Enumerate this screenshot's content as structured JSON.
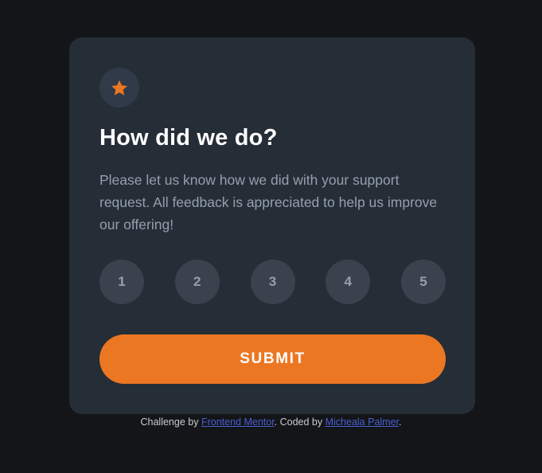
{
  "card": {
    "icon": "star-icon",
    "title": "How did we do?",
    "description": "Please let us know how we did with your support request. All feedback is appreciated to help us improve our offering!",
    "ratings": [
      "1",
      "2",
      "3",
      "4",
      "5"
    ],
    "submit_label": "SUBMIT"
  },
  "attribution": {
    "prefix": "Challenge by ",
    "link1_text": "Frontend Mentor",
    "middle": ". Coded by ",
    "link2_text": "Micheala Palmer",
    "suffix": "."
  },
  "colors": {
    "page_bg": "#131518",
    "card_bg": "#252d37",
    "accent": "#ec7722",
    "rating_bg": "#3a424e",
    "text_muted": "#969fad",
    "link": "#4a5ed0"
  }
}
